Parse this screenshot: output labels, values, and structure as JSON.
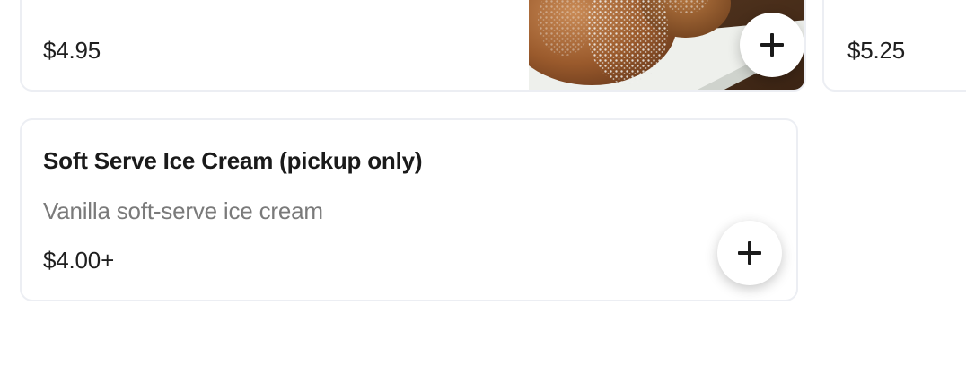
{
  "items": {
    "top_card": {
      "price": "$4.95",
      "image": "powdered-sugar-pastries-photo",
      "add_icon": "plus-icon"
    },
    "right_card": {
      "price": "$5.25"
    },
    "bottom_card": {
      "title": "Soft Serve Ice Cream (pickup only)",
      "description": "Vanilla soft-serve ice cream",
      "price": "$4.00+",
      "add_icon": "plus-icon"
    }
  },
  "colors": {
    "text_primary": "#1f1f1f",
    "text_secondary": "#7a7a7a",
    "card_border": "#eceef3",
    "button_bg": "#ffffff"
  }
}
